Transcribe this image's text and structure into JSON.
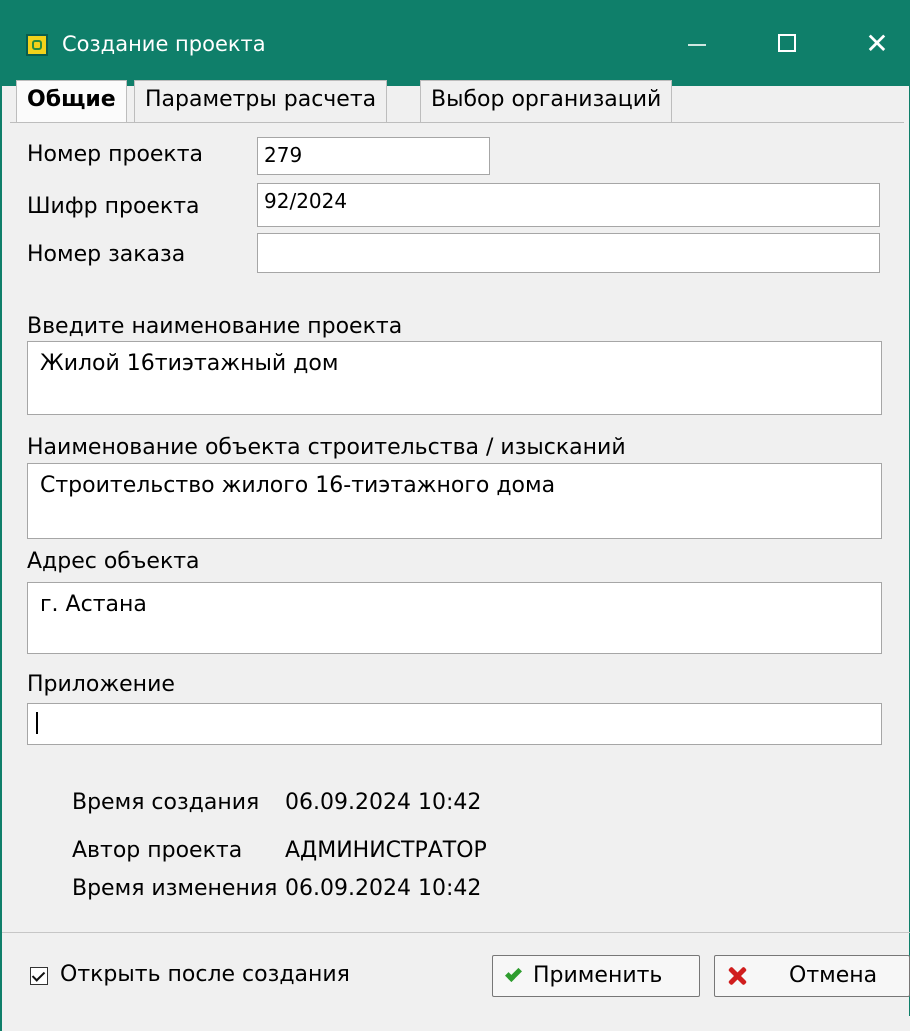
{
  "window": {
    "title": "Создание проекта",
    "min_icon": "minimize-icon",
    "max_icon": "maximize-icon",
    "close_icon": "close-icon"
  },
  "tabs": [
    {
      "label": "Общие",
      "active": true
    },
    {
      "label": "Параметры расчета",
      "active": false
    },
    {
      "label": "Выбор организаций",
      "active": false
    }
  ],
  "form": {
    "project_number": {
      "label": "Номер проекта",
      "value": "279"
    },
    "project_code": {
      "label": "Шифр проекта",
      "value": "92/2024"
    },
    "order_number": {
      "label": "Номер заказа",
      "value": ""
    },
    "project_name": {
      "label": "Введите наименование проекта",
      "value": "Жилой 16тиэтажный дом"
    },
    "construction_object": {
      "label": "Наименование объекта строительства / изысканий",
      "value": "Строительство жилого 16-тиэтажного дома"
    },
    "object_address": {
      "label": "Адрес объекта",
      "value": "г. Астана"
    },
    "attachment": {
      "label": "Приложение",
      "value": ""
    }
  },
  "info": {
    "created_label": "Время создания",
    "created_value": "06.09.2024 10:42",
    "author_label": "Автор проекта",
    "author_value": "АДМИНИСТРАТОР",
    "modified_label": "Время изменения",
    "modified_value": "06.09.2024 10:42"
  },
  "footer": {
    "open_after_create_label": "Открыть после создания",
    "open_after_create_checked": true,
    "apply_label": "Применить",
    "cancel_label": "Отмена"
  },
  "colors": {
    "titlebar": "#0f7f6a",
    "dialog_bg": "#f0f0f0"
  }
}
